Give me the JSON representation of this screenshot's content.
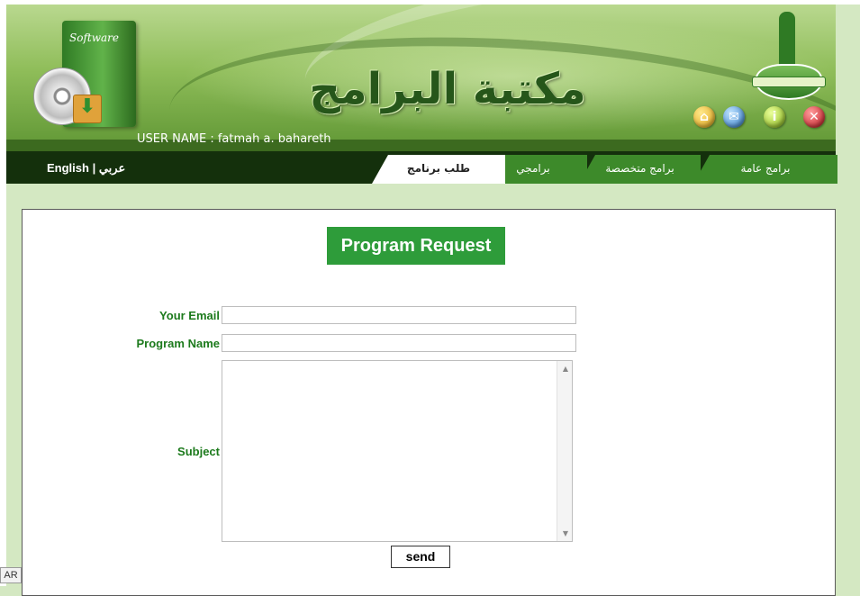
{
  "header": {
    "software_label": "Software",
    "site_title": "مكتبة البرامج",
    "username_label": "USER NAME :",
    "username_value": "fatmah a. bahareth"
  },
  "nav": {
    "lang_english": "English",
    "lang_separator": "|",
    "lang_arabic": "عربي",
    "tabs": [
      {
        "label": "طلب برنامج",
        "active": true
      },
      {
        "label": "برامجي",
        "active": false
      },
      {
        "label": "برامج متخصصة",
        "active": false
      },
      {
        "label": "برامج عامة",
        "active": false
      }
    ]
  },
  "icons": {
    "home": "home-icon",
    "mail": "mail-icon",
    "info": "info-icon",
    "close": "close-icon"
  },
  "form": {
    "title": "Program Request",
    "email_label": "Your Email",
    "email_value": "",
    "program_label": "Program Name",
    "program_value": "",
    "subject_label": "Subject",
    "subject_value": "",
    "send_label": "send"
  },
  "status": {
    "lang_indicator": "AR"
  },
  "colors": {
    "accent": "#2e9c3a",
    "nav_bg": "#14300c",
    "label_green": "#1c7a1c",
    "page_bg": "#d4e8c2"
  }
}
